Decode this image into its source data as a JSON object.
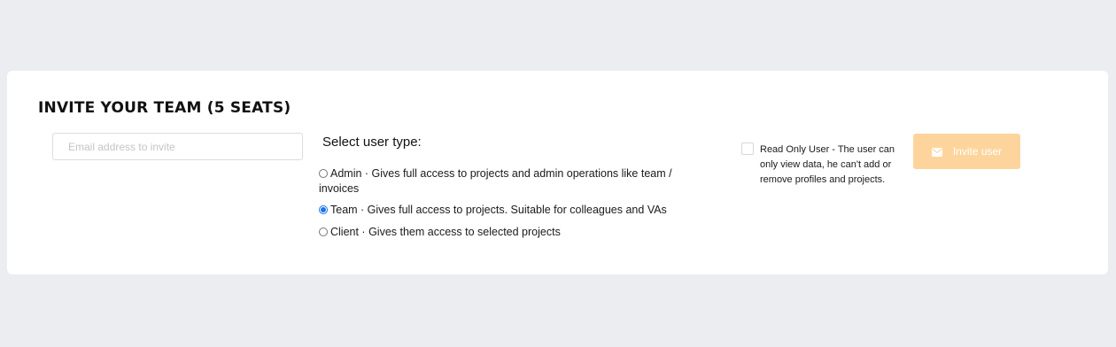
{
  "section": {
    "title": "INVITE YOUR TEAM (5 SEATS)"
  },
  "email_input": {
    "placeholder": "Email address to invite",
    "value": ""
  },
  "user_type": {
    "heading": "Select user type:",
    "selected": "team",
    "options": [
      {
        "id": "admin",
        "label": "Admin · Gives full access to projects and admin operations like team / invoices",
        "checked": false
      },
      {
        "id": "team",
        "label": "Team · Gives full access to projects. Suitable for colleagues and VAs",
        "checked": true
      },
      {
        "id": "client",
        "label": "Client · Gives them access to selected projects",
        "checked": false
      }
    ]
  },
  "read_only": {
    "checked": false,
    "label": "Read Only User - The user can only view data, he can't add or remove profiles and projects."
  },
  "invite_button": {
    "label": "Invite user",
    "icon": "envelope-icon",
    "color": "#fdd59c",
    "text_color": "#ffffff"
  },
  "colors": {
    "page_background": "#ecedf1",
    "card_background": "#ffffff",
    "radio_accent": "#1a73e8"
  }
}
